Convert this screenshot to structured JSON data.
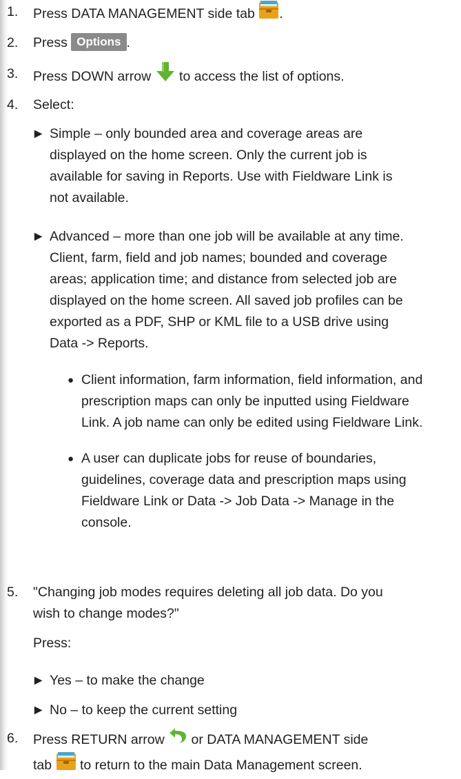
{
  "steps": [
    {
      "num": "1.",
      "before": "Press DATA MANAGEMENT side tab",
      "after": "."
    },
    {
      "num": "2.",
      "before": "Press",
      "button": "Options",
      "after": "."
    },
    {
      "num": "3.",
      "before": "Press DOWN arrow",
      "after": "to access the list of options."
    },
    {
      "num": "4.",
      "text": "Select:"
    },
    {
      "num": "5.",
      "line1": "\"Changing job modes requires deleting all job data. Do you",
      "line2": "wish to change modes?\"",
      "press": "Press:"
    },
    {
      "num": "6.",
      "line1_before": "Press RETURN arrow",
      "line1_after": "or DATA MANAGEMENT side",
      "line2_before": "tab",
      "line2_after": "to return to the main Data Management screen."
    }
  ],
  "options": {
    "simple": [
      "Simple – only bounded area and coverage areas are",
      "displayed on the home screen. Only the current job is",
      "available for saving in Reports. Use with Fieldware Link is",
      "not available."
    ],
    "advanced": [
      "Advanced – more than one job will be available at any time.",
      "Client, farm, field and job names; bounded and coverage",
      "areas; application time; and distance from selected job are",
      "displayed on the home screen. All saved job profiles can be",
      "exported as a PDF, SHP or KML file to a USB drive using",
      "Data -> Reports."
    ],
    "sub1": [
      "Client information, farm information, field information, and",
      "prescription maps can only be inputted using Fieldware",
      "Link. A job name can only be edited using Fieldware Link."
    ],
    "sub2": [
      "A user can duplicate jobs for reuse of boundaries,",
      "guidelines, coverage data and prescription maps using",
      "Fieldware Link or Data -> Job Data -> Manage in the",
      "console."
    ]
  },
  "answers": {
    "yes": "Yes – to make the change",
    "no": "No – to keep the current setting"
  },
  "glyphs": {
    "triangle": "►",
    "dot": "●"
  },
  "icons": [
    "data-management-tab-icon",
    "down-arrow-icon",
    "return-arrow-icon"
  ],
  "colors": {
    "tab_orange": "#e8a21a",
    "tab_blue": "#49a6c9",
    "arrow_green": "#5fb532",
    "button_gray": "#8a8a8a"
  }
}
